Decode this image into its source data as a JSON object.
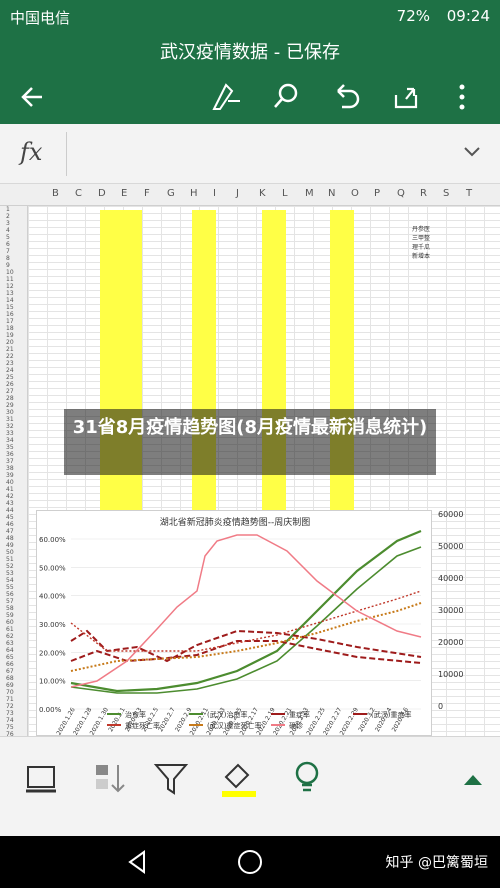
{
  "status_bar": {
    "carrier": "中国电信",
    "network": "4G 2G",
    "battery": "72%",
    "time": "09:24"
  },
  "header": {
    "title": "武汉疫情数据 - 已保存"
  },
  "formula_bar": {
    "fx_label": "fx",
    "value": ""
  },
  "sheet": {
    "columns": [
      "B",
      "C",
      "D",
      "E",
      "F",
      "G",
      "H",
      "I",
      "J",
      "K",
      "L",
      "M",
      "N",
      "O",
      "P",
      "Q",
      "R",
      "S",
      "T"
    ],
    "rows": [
      "1",
      "2",
      "3",
      "4",
      "5",
      "6",
      "7",
      "8",
      "9",
      "10",
      "11",
      "12",
      "13",
      "14",
      "15",
      "16",
      "17",
      "18",
      "19",
      "20",
      "21",
      "22",
      "23",
      "24",
      "25",
      "26",
      "27",
      "28",
      "29",
      "30",
      "31",
      "32",
      "33",
      "34",
      "35",
      "36",
      "37",
      "38",
      "39",
      "40",
      "41",
      "42",
      "43",
      "44",
      "45",
      "46",
      "47",
      "48",
      "49",
      "50",
      "51",
      "52",
      "53",
      "54",
      "55",
      "56",
      "57",
      "58",
      "59",
      "60",
      "61",
      "62",
      "63",
      "64",
      "65",
      "66",
      "67",
      "68",
      "69",
      "70",
      "71",
      "72",
      "73",
      "74",
      "75",
      "76"
    ],
    "side_note": "丹参医三甲整理千瓜新增本"
  },
  "overlay": {
    "text": "31省8月疫情趋势图(8月疫情最新消息统计)"
  },
  "chart": {
    "title": "湖北省新冠肺炎疫情趋势图--周庆制图",
    "left_ticks": [
      "60.00%",
      "50.00%",
      "40.00%",
      "30.00%",
      "20.00%",
      "10.00%",
      "0.00%"
    ],
    "right_ticks": [
      "60000",
      "50000",
      "40000",
      "30000",
      "20000",
      "10000",
      "0"
    ],
    "x_labels": [
      "2020.1.26",
      "2020.1.28",
      "2020.1.30",
      "2020.2.1",
      "2020.2.3",
      "2020.2.5",
      "2020.2.7",
      "2020.2.9",
      "2020.2.11",
      "2020.2.13",
      "2020.2.15",
      "2020.2.17",
      "2020.2.19",
      "2020.2.21",
      "2020.2.23",
      "2020.2.25",
      "2020.2.27",
      "2020.2.29",
      "2020.3.2",
      "2020.3.4",
      "2020.3.6"
    ],
    "legend": [
      "治愈率",
      "(武汉)治愈率",
      "重症率",
      "(武汉)重症率",
      "重症死亡率",
      "(武汉)重症死亡率",
      "确诊"
    ],
    "colors": {
      "green": "#4c8c2f",
      "darkred": "#9e1b1b",
      "red": "#c0392b",
      "orange": "#c77a1a",
      "pink": "#f07b86"
    }
  },
  "watermark": "知乎 @巴篱蜀垣"
}
